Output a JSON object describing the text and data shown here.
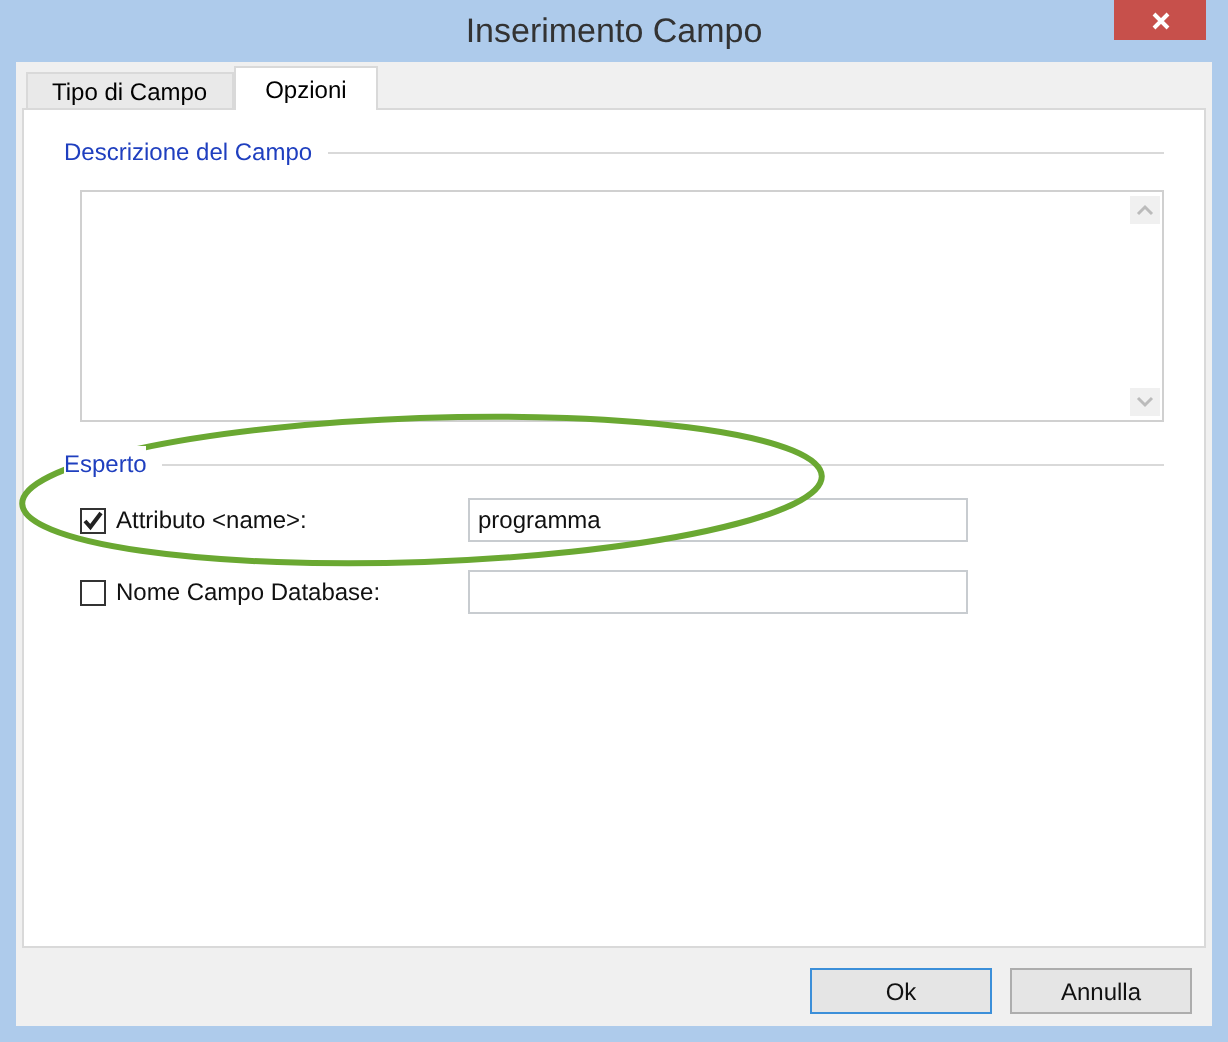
{
  "window": {
    "title": "Inserimento Campo"
  },
  "tabs": [
    {
      "label": "Tipo di Campo",
      "selected": false
    },
    {
      "label": "Opzioni",
      "selected": true
    }
  ],
  "description_group": {
    "label": "Descrizione del Campo"
  },
  "expert_group": {
    "label": "Esperto",
    "fields": [
      {
        "label": "Attributo <name>:",
        "checked": true,
        "value": "programma"
      },
      {
        "label": "Nome Campo Database:",
        "checked": false
      }
    ]
  },
  "annotations": [
    {
      "kind": "ellipse"
    }
  ],
  "buttons": [
    {
      "label": "Ok",
      "default": true
    },
    {
      "label": "Annulla",
      "default": false
    }
  ]
}
